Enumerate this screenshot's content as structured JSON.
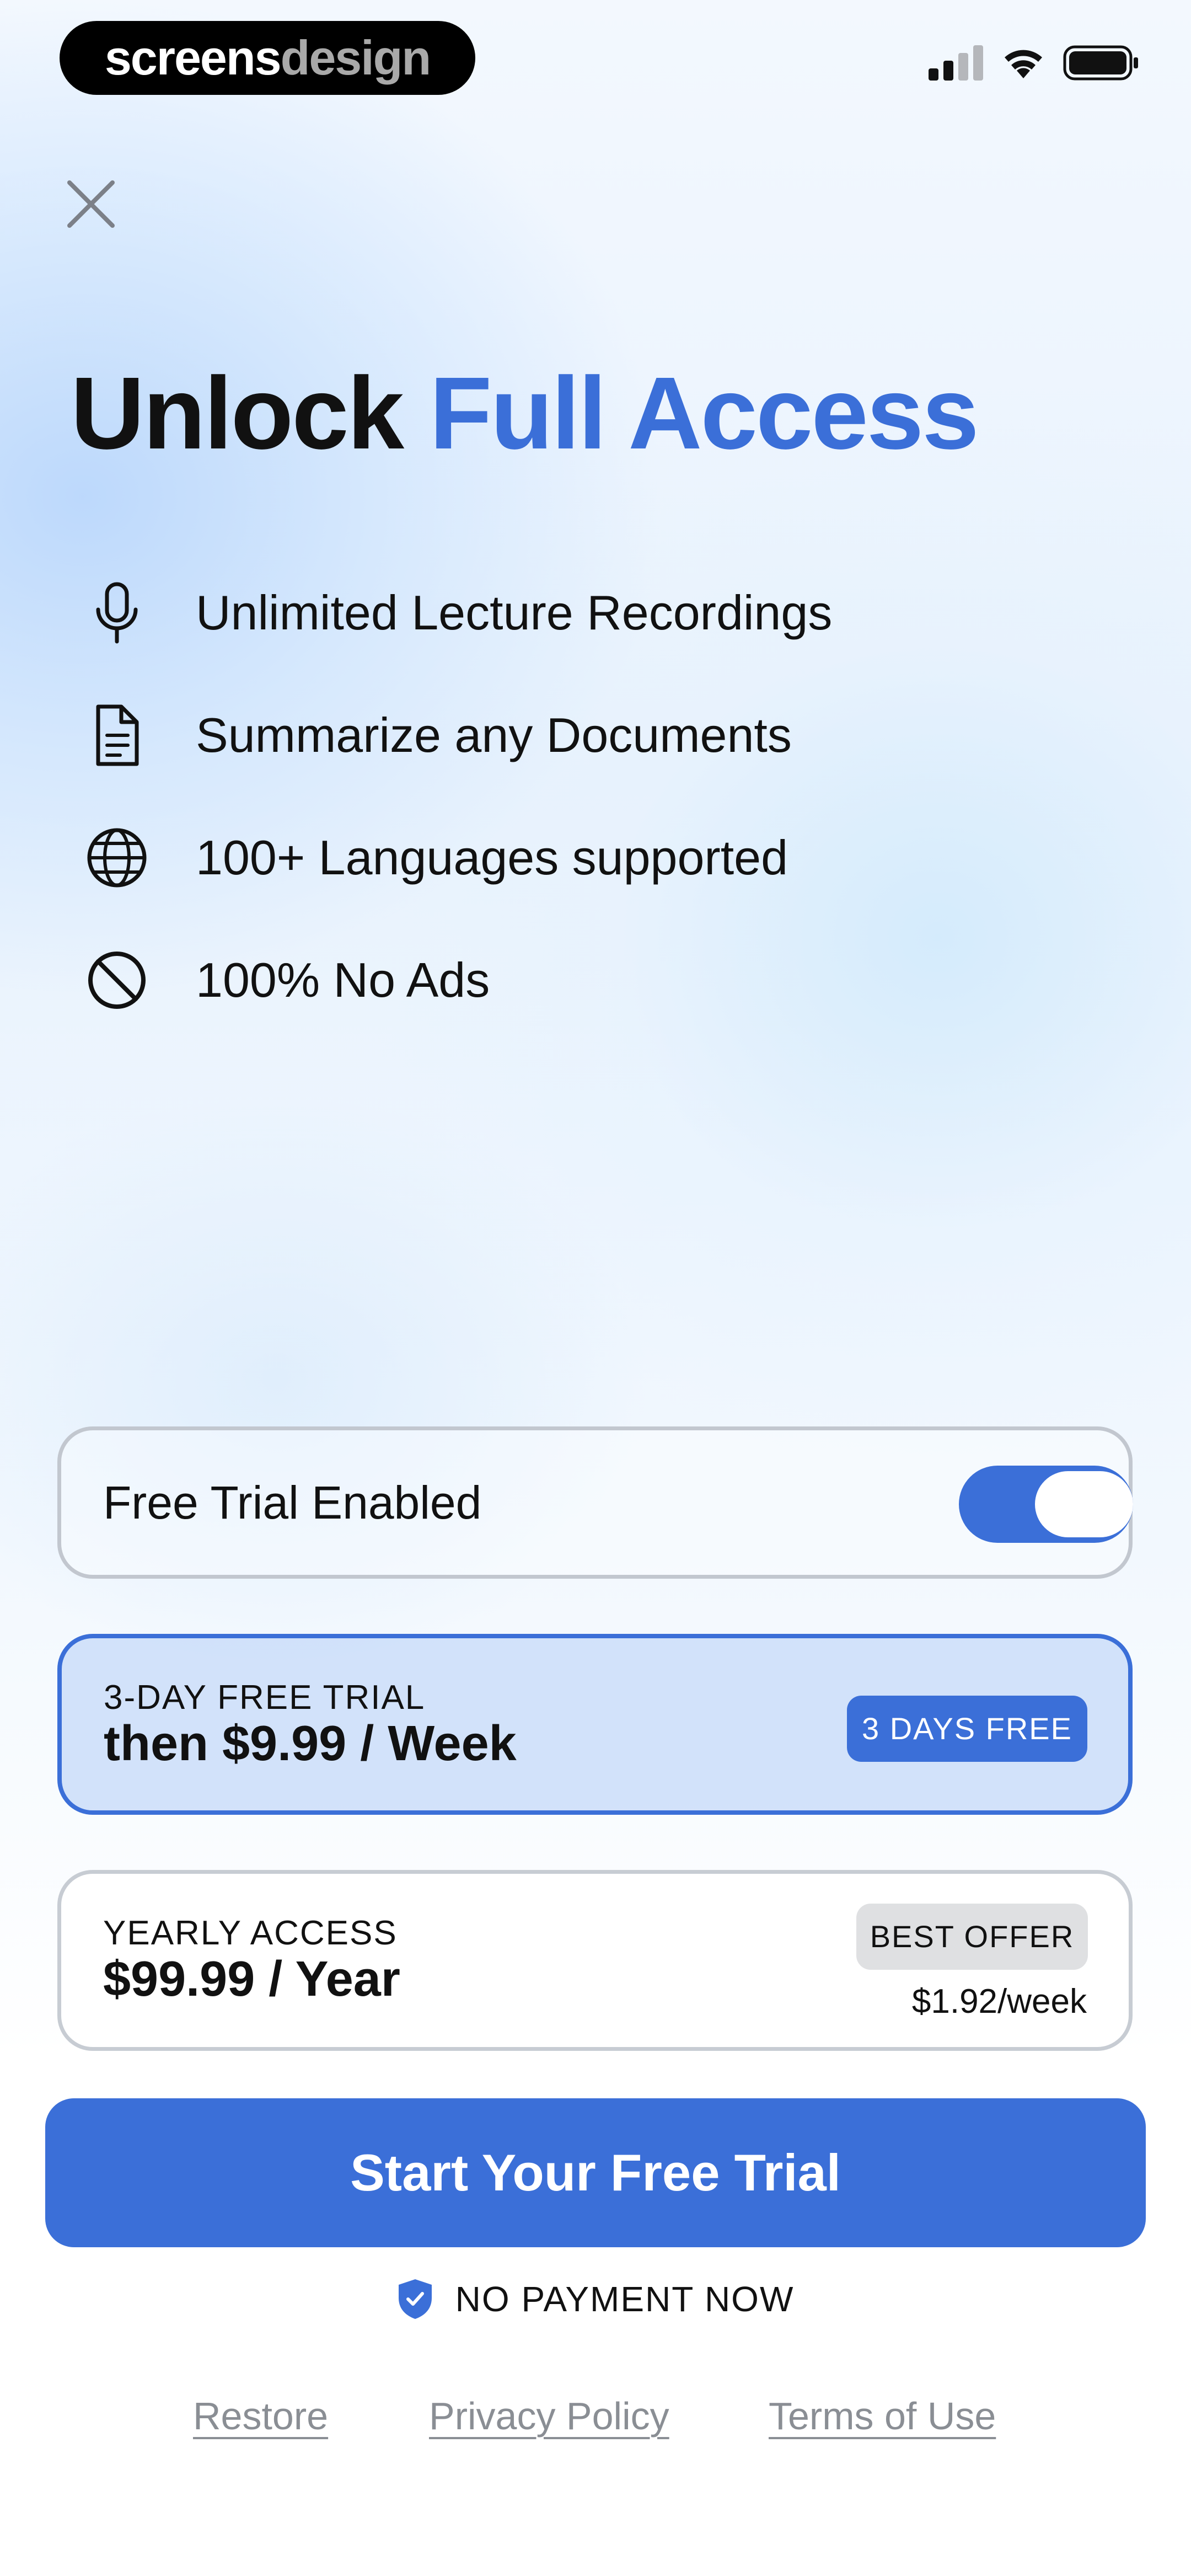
{
  "status_bar": {
    "brand_part1": "screens",
    "brand_part2": "design"
  },
  "header": {
    "close_icon": "close-icon",
    "title_plain": "Unlock ",
    "title_accent": "Full Access"
  },
  "features": [
    {
      "icon": "microphone-icon",
      "label": "Unlimited Lecture Recordings"
    },
    {
      "icon": "document-icon",
      "label": "Summarize any Documents"
    },
    {
      "icon": "globe-icon",
      "label": "100+ Languages supported"
    },
    {
      "icon": "no-ads-icon",
      "label": "100% No Ads"
    }
  ],
  "free_trial": {
    "label": "Free Trial Enabled",
    "enabled": true
  },
  "plans": [
    {
      "subtitle": "3-DAY FREE TRIAL",
      "price": "then $9.99 / Week",
      "badge": "3 DAYS FREE",
      "selected": true
    },
    {
      "subtitle": "YEARLY ACCESS",
      "price": "$99.99 / Year",
      "badge": "BEST OFFER",
      "per_week": "$1.92/week",
      "selected": false
    }
  ],
  "cta": {
    "label": "Start Your Free Trial"
  },
  "no_payment": {
    "icon": "shield-check-icon",
    "label": "NO PAYMENT NOW"
  },
  "footer": {
    "restore": "Restore",
    "privacy": "Privacy Policy",
    "terms": "Terms of Use"
  },
  "colors": {
    "accent": "#3b6fd8",
    "text": "#111111",
    "muted": "#8a8e94"
  }
}
